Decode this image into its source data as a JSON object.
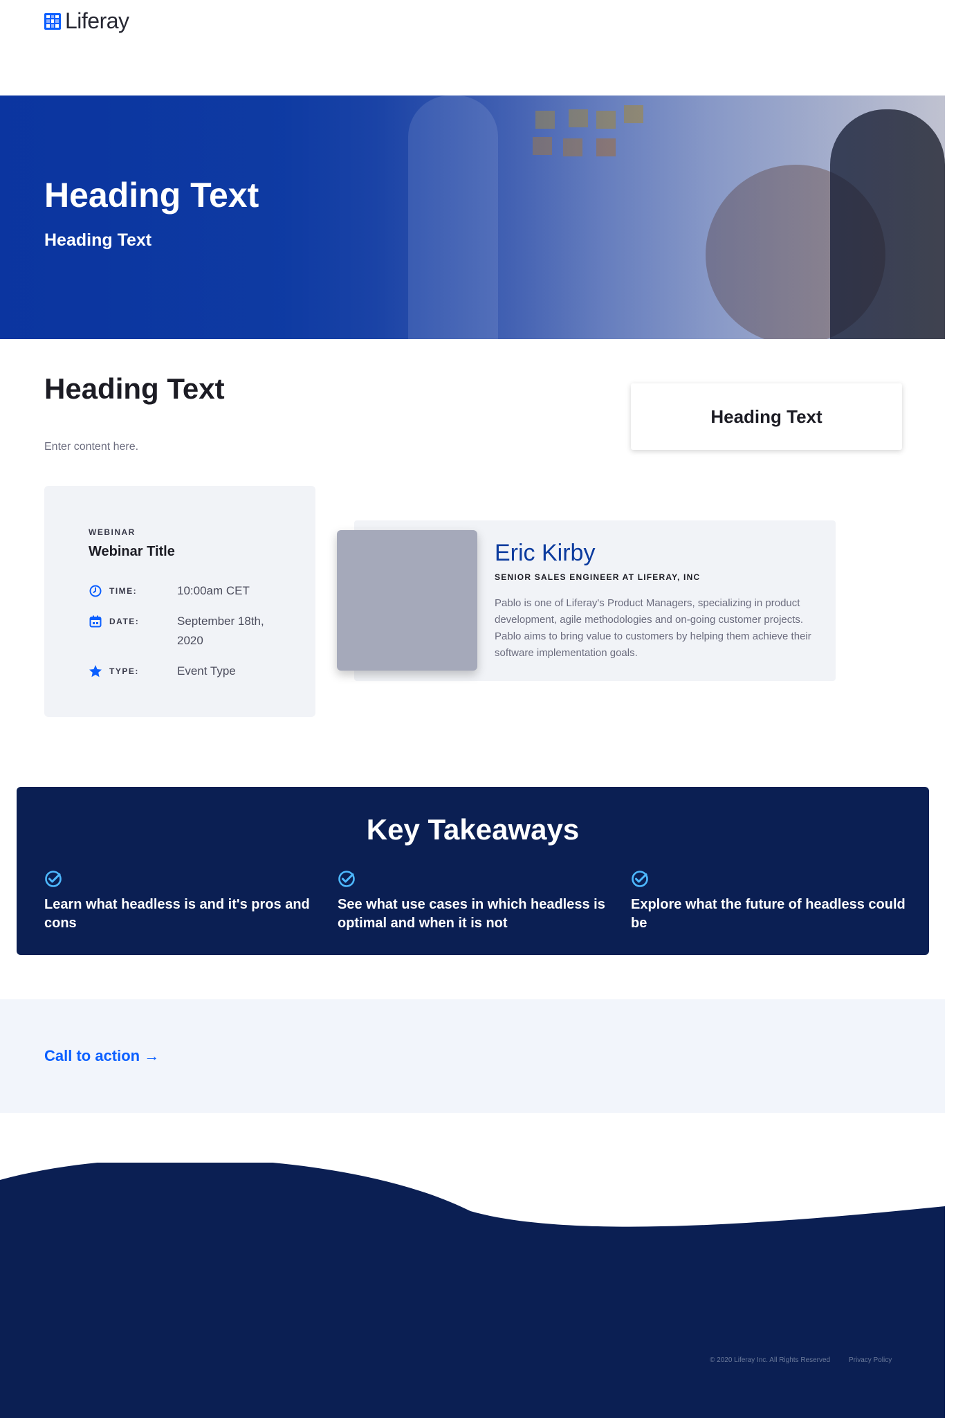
{
  "header": {
    "logo_text": "Liferay"
  },
  "hero": {
    "title": "Heading Text",
    "subtitle": "Heading Text"
  },
  "intro": {
    "heading": "Heading Text",
    "content": "Enter content here.",
    "side_card_heading": "Heading Text"
  },
  "webinar": {
    "kicker": "WEBINAR",
    "title": "Webinar Title",
    "rows": [
      {
        "icon": "clock-icon",
        "label": "TIME:",
        "value": "10:00am CET"
      },
      {
        "icon": "calendar-icon",
        "label": "DATE:",
        "value": "September 18th, 2020"
      },
      {
        "icon": "star-icon",
        "label": "TYPE:",
        "value": "Event Type"
      }
    ]
  },
  "speaker": {
    "name": "Eric Kirby",
    "role": "SENIOR SALES ENGINEER AT LIFERAY, INC",
    "bio": "Pablo is one of Liferay's Product Managers, specializing in product development, agile methodologies and on-going customer projects. Pablo aims to bring value to customers by helping them achieve their software implementation goals."
  },
  "takeaways": {
    "title": "Key Takeaways",
    "items": [
      "Learn what headless is and it's pros and cons",
      "See what use cases in which headless is optimal and when it is not",
      "Explore what the future of headless could be"
    ]
  },
  "cta": {
    "label": "Call to action →"
  },
  "footer": {
    "copyright": "© 2020 Liferay Inc. All Rights Reserved",
    "privacy": "Privacy Policy"
  },
  "colors": {
    "primary": "#0b5fff",
    "navy": "#0b1f53",
    "hero_blue": "#0c3b9e",
    "check": "#4db8ff"
  }
}
